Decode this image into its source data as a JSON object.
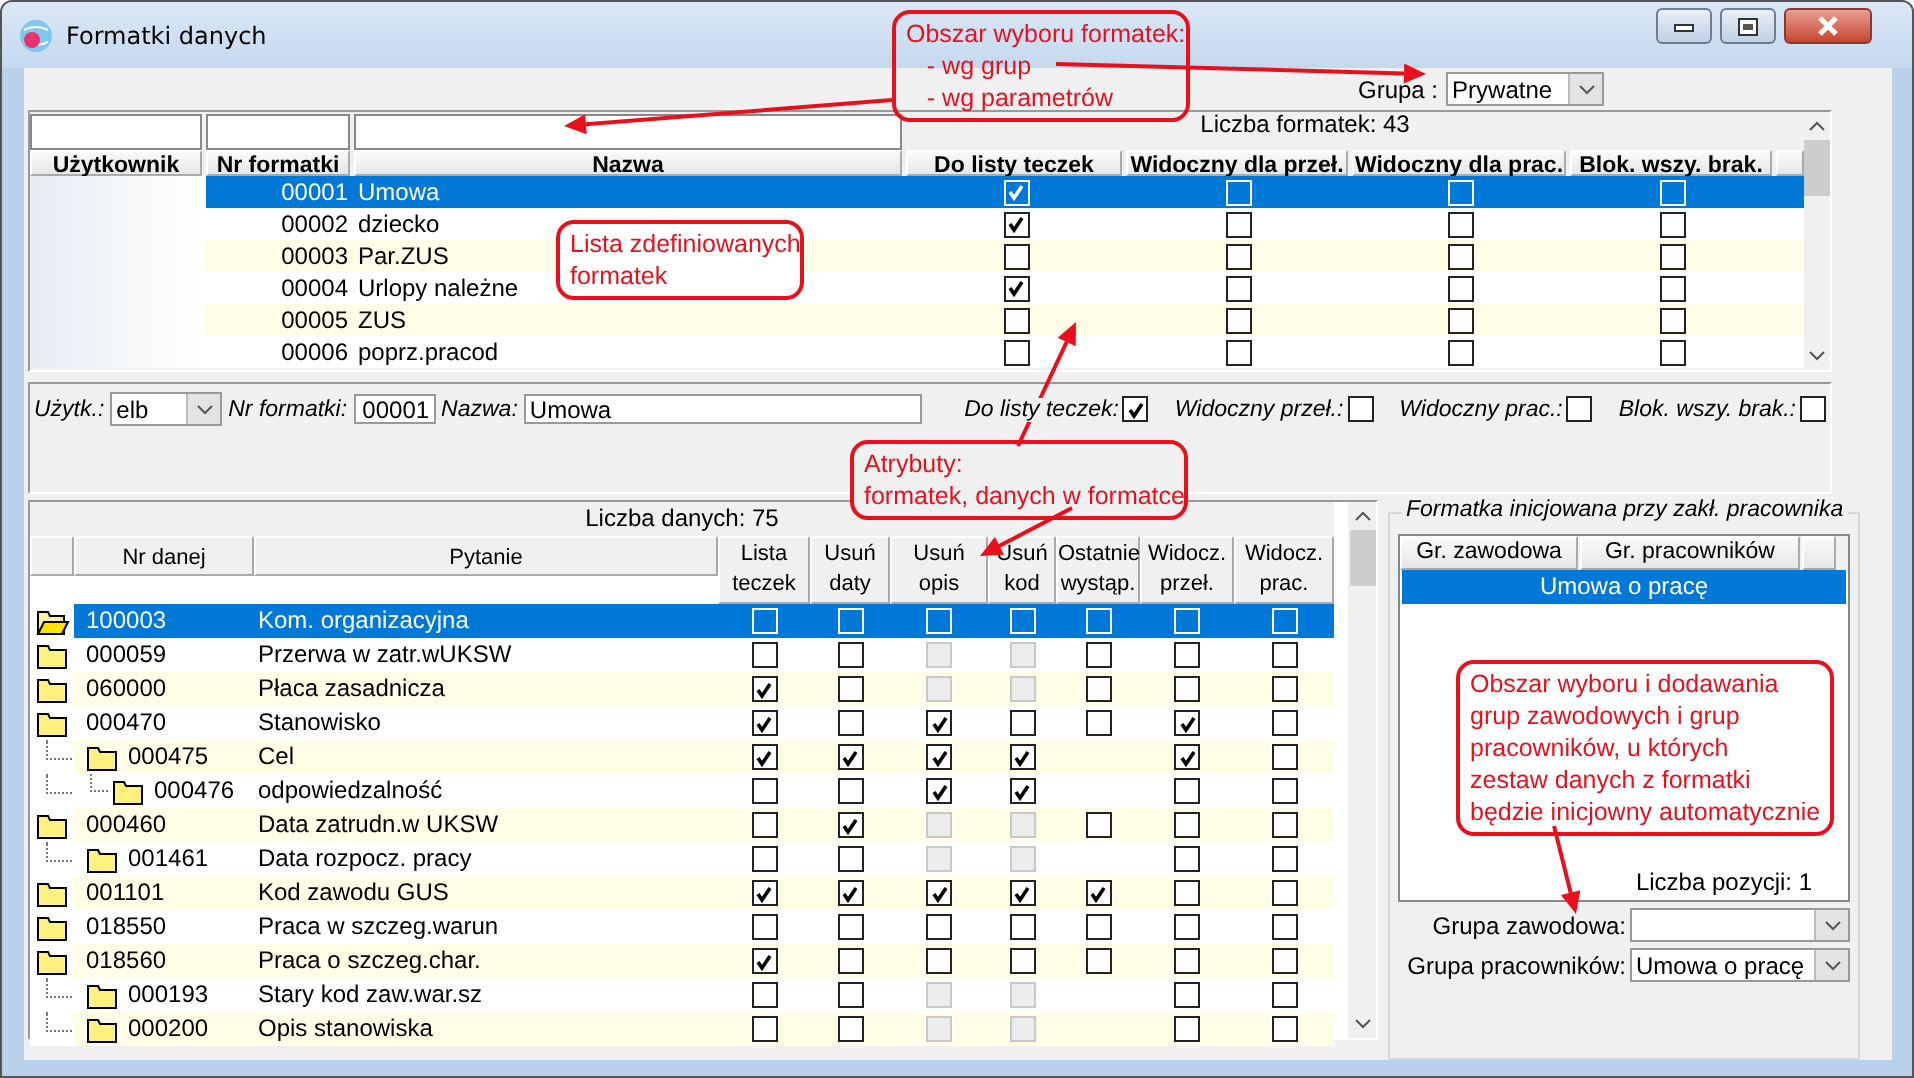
{
  "window": {
    "title": "Formatki danych"
  },
  "group_filter": {
    "label": "Grupa :",
    "value": "Prywatne"
  },
  "templates": {
    "count_label": "Liczba formatek: 43",
    "columns": [
      "Użytkownik",
      "Nr formatki",
      "Nazwa",
      "Do listy teczek",
      "Widoczny dla przeł.",
      "Widoczny dla prac.",
      "Blok. wszy. brak."
    ],
    "rows": [
      {
        "number": "00001",
        "name": "Umowa",
        "selected": true,
        "checks": [
          true,
          false,
          false,
          false
        ]
      },
      {
        "number": "00002",
        "name": "dziecko",
        "selected": false,
        "checks": [
          true,
          false,
          false,
          false
        ]
      },
      {
        "number": "00003",
        "name": "Par.ZUS",
        "selected": false,
        "checks": [
          false,
          false,
          false,
          false
        ]
      },
      {
        "number": "00004",
        "name": "Urlopy należne",
        "selected": false,
        "checks": [
          true,
          false,
          false,
          false
        ]
      },
      {
        "number": "00005",
        "name": "ZUS",
        "selected": false,
        "checks": [
          false,
          false,
          false,
          false
        ]
      },
      {
        "number": "00006",
        "name": "poprz.pracod",
        "selected": false,
        "checks": [
          false,
          false,
          false,
          false
        ]
      }
    ]
  },
  "attributes": {
    "user": {
      "label": "Użytk.:",
      "value": "elb"
    },
    "number": {
      "label": "Nr formatki:",
      "value": "00001"
    },
    "name": {
      "label": "Nazwa:",
      "value": "Umowa"
    },
    "checks": [
      {
        "label": "Do listy teczek:",
        "checked": true
      },
      {
        "label": "Widoczny przeł.:",
        "checked": false
      },
      {
        "label": "Widoczny prac.:",
        "checked": false
      },
      {
        "label": "Blok. wszy. brak.:",
        "checked": false
      }
    ]
  },
  "data_items": {
    "count_label": "Liczba danych: 75",
    "columns": [
      "Nr danej",
      "Pytanie",
      "Lista\nteczek",
      "Usuń\ndaty",
      "Usuń\nopis",
      "Usuń\nkod",
      "Ostatnie\nwystąp.",
      "Widocz.\nprzeł.",
      "Widocz.\nprac."
    ],
    "rows": [
      {
        "number": "100003",
        "question": "Kom. organizacyjna",
        "selected": true,
        "cells": [
          {
            "kind": "checkbox",
            "checked": false,
            "disabled": false
          },
          {
            "kind": "checkbox",
            "checked": false,
            "disabled": false
          },
          {
            "kind": "checkbox",
            "checked": false,
            "disabled": false
          },
          {
            "kind": "checkbox",
            "checked": false,
            "disabled": false
          },
          {
            "kind": "checkbox",
            "checked": false,
            "disabled": false
          },
          {
            "kind": "checkbox",
            "checked": false,
            "disabled": false
          },
          {
            "kind": "checkbox",
            "checked": false,
            "disabled": false
          }
        ]
      },
      {
        "number": "000059",
        "question": "Przerwa w zatr.wUKSW",
        "selected": false,
        "cells": [
          {
            "kind": "checkbox",
            "checked": false,
            "disabled": false
          },
          {
            "kind": "checkbox",
            "checked": false,
            "disabled": false
          },
          {
            "kind": "checkbox",
            "checked": false,
            "disabled": true
          },
          {
            "kind": "checkbox",
            "checked": false,
            "disabled": true
          },
          {
            "kind": "checkbox",
            "checked": false,
            "disabled": false
          },
          {
            "kind": "checkbox",
            "checked": false,
            "disabled": false
          },
          {
            "kind": "checkbox",
            "checked": false,
            "disabled": false
          }
        ]
      },
      {
        "number": "060000",
        "question": "Płaca zasadnicza",
        "selected": false,
        "cells": [
          {
            "kind": "checkbox",
            "checked": true,
            "disabled": false
          },
          {
            "kind": "checkbox",
            "checked": false,
            "disabled": false
          },
          {
            "kind": "checkbox",
            "checked": false,
            "disabled": true
          },
          {
            "kind": "checkbox",
            "checked": false,
            "disabled": true
          },
          {
            "kind": "checkbox",
            "checked": false,
            "disabled": false
          },
          {
            "kind": "checkbox",
            "checked": false,
            "disabled": false
          },
          {
            "kind": "checkbox",
            "checked": false,
            "disabled": false
          }
        ]
      },
      {
        "number": "000470",
        "question": "Stanowisko",
        "selected": false,
        "cells": [
          {
            "kind": "checkbox",
            "checked": true,
            "disabled": false
          },
          {
            "kind": "checkbox",
            "checked": false,
            "disabled": false
          },
          {
            "kind": "checkbox",
            "checked": true,
            "disabled": false
          },
          {
            "kind": "checkbox",
            "checked": false,
            "disabled": false
          },
          {
            "kind": "checkbox",
            "checked": false,
            "disabled": false
          },
          {
            "kind": "checkbox",
            "checked": true,
            "disabled": false
          },
          {
            "kind": "checkbox",
            "checked": false,
            "disabled": false
          }
        ],
        "children": [
          {
            "number": "000475",
            "question": "Cel",
            "selected": false,
            "cells": [
              {
                "kind": "checkbox",
                "checked": true,
                "disabled": false
              },
              {
                "kind": "checkbox",
                "checked": true,
                "disabled": false
              },
              {
                "kind": "checkbox",
                "checked": true,
                "disabled": false
              },
              {
                "kind": "checkbox",
                "checked": true,
                "disabled": false
              },
              {
                "kind": "blank"
              },
              {
                "kind": "checkbox",
                "checked": true,
                "disabled": false
              },
              {
                "kind": "checkbox",
                "checked": false,
                "disabled": false
              }
            ],
            "children": [
              {
                "number": "000476",
                "question": "odpowiedzalność",
                "selected": false,
                "cells": [
                  {
                    "kind": "checkbox",
                    "checked": false,
                    "disabled": false
                  },
                  {
                    "kind": "checkbox",
                    "checked": false,
                    "disabled": false
                  },
                  {
                    "kind": "checkbox",
                    "checked": true,
                    "disabled": false
                  },
                  {
                    "kind": "checkbox",
                    "checked": true,
                    "disabled": false
                  },
                  {
                    "kind": "blank"
                  },
                  {
                    "kind": "checkbox",
                    "checked": false,
                    "disabled": false
                  },
                  {
                    "kind": "checkbox",
                    "checked": false,
                    "disabled": false
                  }
                ]
              }
            ]
          }
        ]
      },
      {
        "number": "000460",
        "question": "Data zatrudn.w UKSW",
        "selected": false,
        "cells": [
          {
            "kind": "checkbox",
            "checked": false,
            "disabled": false
          },
          {
            "kind": "checkbox",
            "checked": true,
            "disabled": false
          },
          {
            "kind": "checkbox",
            "checked": false,
            "disabled": true
          },
          {
            "kind": "checkbox",
            "checked": false,
            "disabled": true
          },
          {
            "kind": "checkbox",
            "checked": false,
            "disabled": false
          },
          {
            "kind": "checkbox",
            "checked": false,
            "disabled": false
          },
          {
            "kind": "checkbox",
            "checked": false,
            "disabled": false
          }
        ],
        "children": [
          {
            "number": "001461",
            "question": "Data rozpocz. pracy",
            "selected": false,
            "cells": [
              {
                "kind": "checkbox",
                "checked": false,
                "disabled": false
              },
              {
                "kind": "checkbox",
                "checked": false,
                "disabled": false
              },
              {
                "kind": "checkbox",
                "checked": false,
                "disabled": true
              },
              {
                "kind": "checkbox",
                "checked": false,
                "disabled": true
              },
              {
                "kind": "blank"
              },
              {
                "kind": "checkbox",
                "checked": false,
                "disabled": false
              },
              {
                "kind": "checkbox",
                "checked": false,
                "disabled": false
              }
            ]
          }
        ]
      },
      {
        "number": "001101",
        "question": "Kod zawodu GUS",
        "selected": false,
        "cells": [
          {
            "kind": "checkbox",
            "checked": true,
            "disabled": false
          },
          {
            "kind": "checkbox",
            "checked": true,
            "disabled": false
          },
          {
            "kind": "checkbox",
            "checked": true,
            "disabled": false
          },
          {
            "kind": "checkbox",
            "checked": true,
            "disabled": false
          },
          {
            "kind": "checkbox",
            "checked": true,
            "disabled": false
          },
          {
            "kind": "checkbox",
            "checked": false,
            "disabled": false
          },
          {
            "kind": "checkbox",
            "checked": false,
            "disabled": false
          }
        ]
      },
      {
        "number": "018550",
        "question": "Praca w szczeg.warun",
        "selected": false,
        "cells": [
          {
            "kind": "checkbox",
            "checked": false,
            "disabled": false
          },
          {
            "kind": "checkbox",
            "checked": false,
            "disabled": false
          },
          {
            "kind": "checkbox",
            "checked": false,
            "disabled": false
          },
          {
            "kind": "checkbox",
            "checked": false,
            "disabled": false
          },
          {
            "kind": "checkbox",
            "checked": false,
            "disabled": false
          },
          {
            "kind": "checkbox",
            "checked": false,
            "disabled": false
          },
          {
            "kind": "checkbox",
            "checked": false,
            "disabled": false
          }
        ]
      },
      {
        "number": "018560",
        "question": "Praca o szczeg.char.",
        "selected": false,
        "cells": [
          {
            "kind": "checkbox",
            "checked": true,
            "disabled": false
          },
          {
            "kind": "checkbox",
            "checked": false,
            "disabled": false
          },
          {
            "kind": "checkbox",
            "checked": false,
            "disabled": false
          },
          {
            "kind": "checkbox",
            "checked": false,
            "disabled": false
          },
          {
            "kind": "checkbox",
            "checked": false,
            "disabled": false
          },
          {
            "kind": "checkbox",
            "checked": false,
            "disabled": false
          },
          {
            "kind": "checkbox",
            "checked": false,
            "disabled": false
          }
        ],
        "children": [
          {
            "number": "000193",
            "question": "Stary kod zaw.war.sz",
            "selected": false,
            "cells": [
              {
                "kind": "checkbox",
                "checked": false,
                "disabled": false
              },
              {
                "kind": "checkbox",
                "checked": false,
                "disabled": false
              },
              {
                "kind": "checkbox",
                "checked": false,
                "disabled": true
              },
              {
                "kind": "checkbox",
                "checked": false,
                "disabled": true
              },
              {
                "kind": "blank"
              },
              {
                "kind": "checkbox",
                "checked": false,
                "disabled": false
              },
              {
                "kind": "checkbox",
                "checked": false,
                "disabled": false
              }
            ]
          },
          {
            "number": "000200",
            "question": "Opis stanowiska",
            "selected": false,
            "cells": [
              {
                "kind": "checkbox",
                "checked": false,
                "disabled": false
              },
              {
                "kind": "checkbox",
                "checked": false,
                "disabled": false
              },
              {
                "kind": "checkbox",
                "checked": false,
                "disabled": true
              },
              {
                "kind": "checkbox",
                "checked": false,
                "disabled": true
              },
              {
                "kind": "blank"
              },
              {
                "kind": "checkbox",
                "checked": false,
                "disabled": false
              },
              {
                "kind": "checkbox",
                "checked": false,
                "disabled": false
              }
            ]
          }
        ]
      }
    ]
  },
  "init_groups": {
    "title": "Formatka inicjowana przy zakł. pracownika",
    "columns": [
      "Gr. zawodowa",
      "Gr. pracowników"
    ],
    "rows": [
      {
        "text": "Umowa o pracę",
        "selected": true
      }
    ],
    "count_label": "Liczba pozycji: 1",
    "fields": [
      {
        "label": "Grupa zawodowa:"
      },
      {
        "label": "Grupa pracowników:",
        "value": "Umowa o pracę"
      }
    ]
  },
  "annotations": [
    {
      "text": "Obszar wyboru formatek:\n   - wg grup\n   - wg parametrów"
    },
    {
      "text": "Lista zdefiniowanych\nformatek"
    },
    {
      "text": "Atrybuty:\nformatek, danych w formatce"
    },
    {
      "text": "Obszar wyboru i dodawania\ngrup zawodowych i grup\npracowników, u których\nzestaw danych z formatki\nbędzie inicjowny automatycznie"
    }
  ]
}
